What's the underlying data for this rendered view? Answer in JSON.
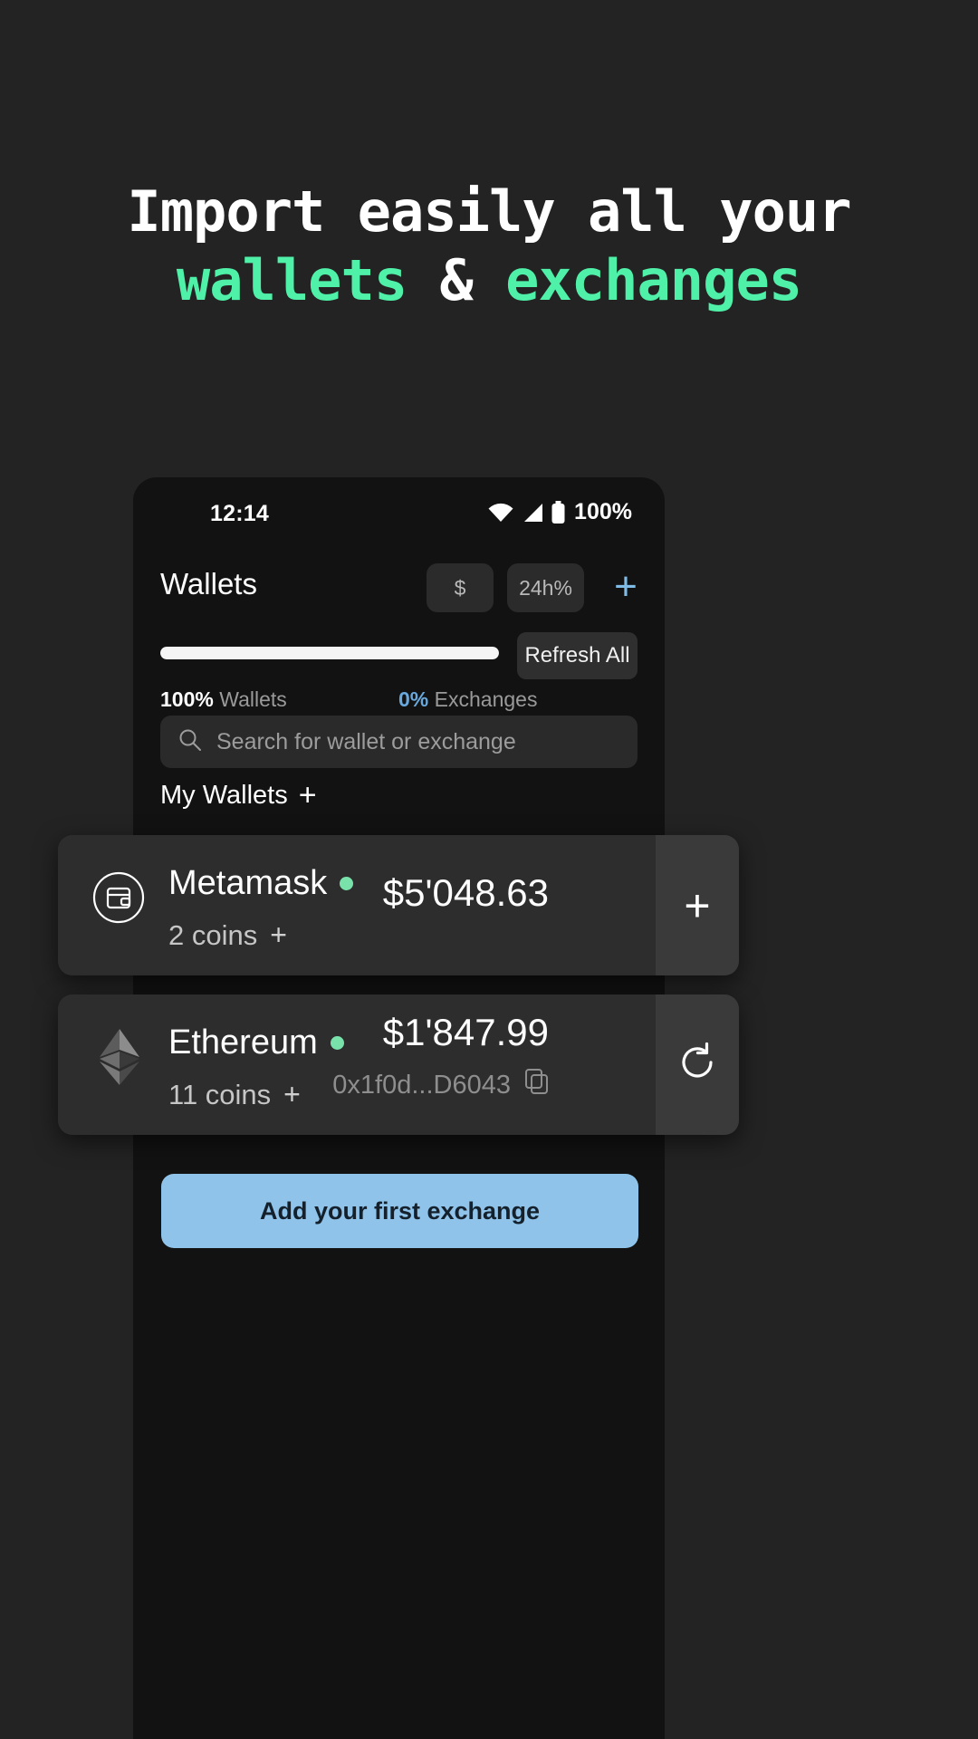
{
  "headline": {
    "line1": "Import easily all your",
    "line2_part1": "wallets",
    "line2_amp": "&",
    "line2_part2": "exchanges",
    "accent_color": "#4ff0a8"
  },
  "phone": {
    "status_bar": {
      "time": "12:14",
      "battery_percent": "100%",
      "wifi_icon": "wifi-icon",
      "signal_icon": "cellular-signal-icon",
      "battery_icon": "battery-icon"
    },
    "header": {
      "title": "Wallets",
      "chip_currency": "$",
      "chip_change": "24h%",
      "add_icon": "plus-icon",
      "add_color": "#7fbde8"
    },
    "progress": {
      "fill_percent": 100,
      "refresh_label": "Refresh All",
      "legend": [
        {
          "value": "100%",
          "label": "Wallets",
          "color": "#ffffff"
        },
        {
          "value": "0%",
          "label": "Exchanges",
          "color": "#6aa9dd"
        }
      ]
    },
    "search": {
      "placeholder": "Search for wallet or exchange",
      "icon": "search-icon"
    },
    "section": {
      "title": "My Wallets",
      "add_icon": "plus-icon"
    },
    "wallets": [
      {
        "name": "Metamask",
        "icon": "wallet-icon",
        "status_dot_color": "#79e2ab",
        "coins": "2 coins",
        "coins_add_icon": "plus-icon",
        "amount": "$5'048.63",
        "address": "",
        "action_icon": "plus-icon"
      },
      {
        "name": "Ethereum",
        "icon": "ethereum-icon",
        "status_dot_color": "#79e2ab",
        "coins": "11 coins",
        "coins_add_icon": "plus-icon",
        "amount": "$1'847.99",
        "address": "0x1f0d...D6043",
        "copy_icon": "copy-icon",
        "action_icon": "refresh-icon"
      }
    ],
    "cta": {
      "label": "Add your first exchange",
      "color": "#8fc3ea"
    }
  }
}
